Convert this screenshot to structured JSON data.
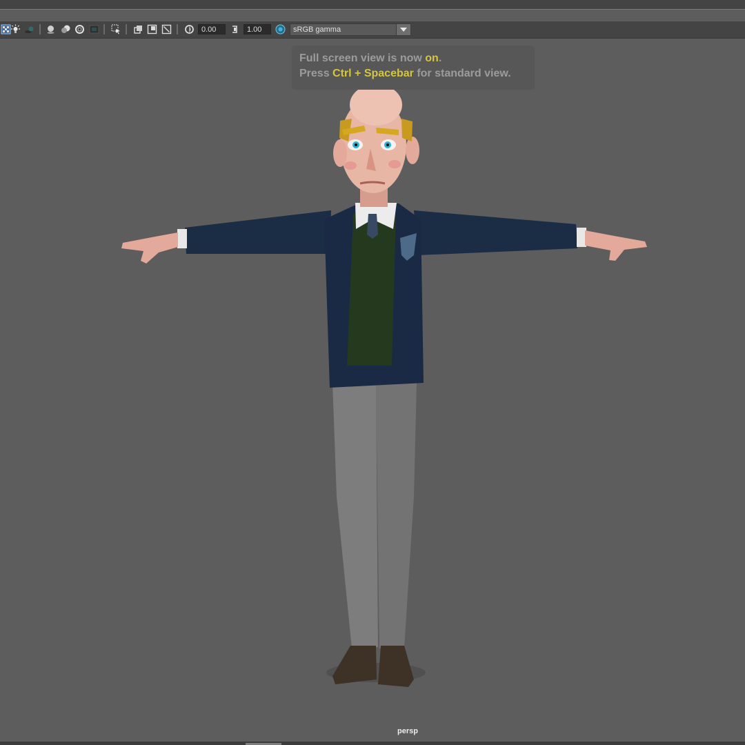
{
  "toolbar": {
    "icons": [
      "checker-icon",
      "light-icon",
      "shadow-icon",
      "sphere-icon",
      "ambient-occlusion-icon",
      "wireframe-ring-icon",
      "film-gate-icon",
      "select-region-icon",
      "isolate-select-icon",
      "xray-icon",
      "xray-joints-icon",
      "exposure-icon",
      "gamma-icon",
      "color-management-icon"
    ],
    "exposure_value": "0.00",
    "gamma_value": "1.00",
    "color_space": "sRGB gamma"
  },
  "hud": {
    "line1_prefix": "Full screen view is now ",
    "line1_highlight": "on",
    "line1_suffix": ".",
    "line2_prefix": "Press ",
    "line2_highlight": "Ctrl + Spacebar",
    "line2_suffix": " for standard view."
  },
  "viewport": {
    "camera_label": "persp"
  },
  "colors": {
    "viewport_background": "#5d5d5d",
    "toolbar_background": "#444444",
    "hud_highlight": "#d6c63c",
    "hud_text": "#9c9c9c"
  }
}
